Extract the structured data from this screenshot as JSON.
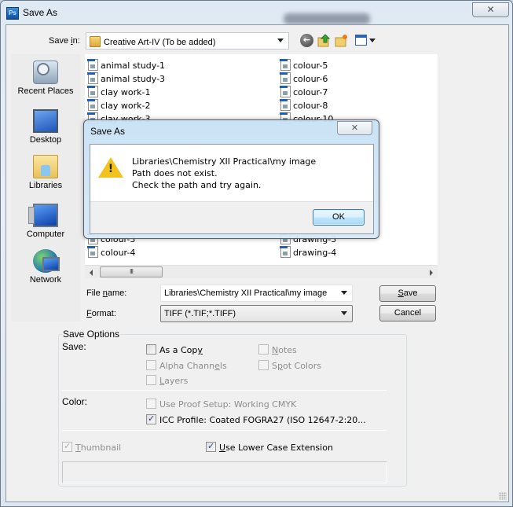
{
  "window": {
    "app_icon_label": "Ps",
    "title": "Save As",
    "close_glyph": "✕"
  },
  "toolbar": {
    "save_in_label": "Save in:",
    "save_in_value": "Creative Art-IV (To be added)",
    "back_glyph": "←"
  },
  "places": [
    {
      "label": "Recent Places",
      "icon": "recent-places-icon"
    },
    {
      "label": "Desktop",
      "icon": "desktop-icon"
    },
    {
      "label": "Libraries",
      "icon": "libraries-icon"
    },
    {
      "label": "Computer",
      "icon": "computer-icon"
    },
    {
      "label": "Network",
      "icon": "network-icon"
    }
  ],
  "files": {
    "column1": [
      "animal study-1",
      "animal study-3",
      "clay work-1",
      "clay work-2",
      "clay work-3",
      "colour-3",
      "colour-4"
    ],
    "column2": [
      "colour-5",
      "colour-6",
      "colour-7",
      "colour-8",
      "colour-10",
      "drawing-3",
      "drawing-4"
    ]
  },
  "scrollbar": {
    "thumb_glyph": "III"
  },
  "file_name": {
    "label": "File name:",
    "value": "Libraries\\Chemistry XII Practical\\my image"
  },
  "format": {
    "label": "Format:",
    "value": "TIFF (*.TIF;*.TIFF)"
  },
  "buttons": {
    "save": "Save",
    "cancel": "Cancel"
  },
  "save_options": {
    "title": "Save Options",
    "save_label": "Save:",
    "checkboxes": {
      "as_a_copy": {
        "label": "As a Copy",
        "checked": false,
        "enabled": true
      },
      "notes": {
        "label": "Notes",
        "checked": false,
        "enabled": false
      },
      "alpha_channels": {
        "label": "Alpha Channels",
        "checked": false,
        "enabled": false
      },
      "spot_colors": {
        "label": "Spot Colors",
        "checked": false,
        "enabled": false
      },
      "layers": {
        "label": "Layers",
        "checked": false,
        "enabled": false
      }
    },
    "color_label": "Color:",
    "use_proof_setup": {
      "label": "Use Proof Setup:  Working CMYK",
      "checked": false,
      "enabled": false
    },
    "icc_profile": {
      "label": "ICC Profile:  Coated FOGRA27 (ISO 12647-2:20...",
      "checked": true,
      "enabled": true
    },
    "thumbnail": {
      "label": "Thumbnail",
      "checked": true,
      "enabled": false
    },
    "lower_case_ext": {
      "label": "Use Lower Case Extension",
      "checked": true,
      "enabled": true
    }
  },
  "alert": {
    "title": "Save As",
    "close_glyph": "✕",
    "icon": "warning-icon",
    "message_lines": [
      "Libraries\\Chemistry XII Practical\\my image",
      "Path does not exist.",
      "Check the path and try again."
    ],
    "ok_label": "OK"
  }
}
